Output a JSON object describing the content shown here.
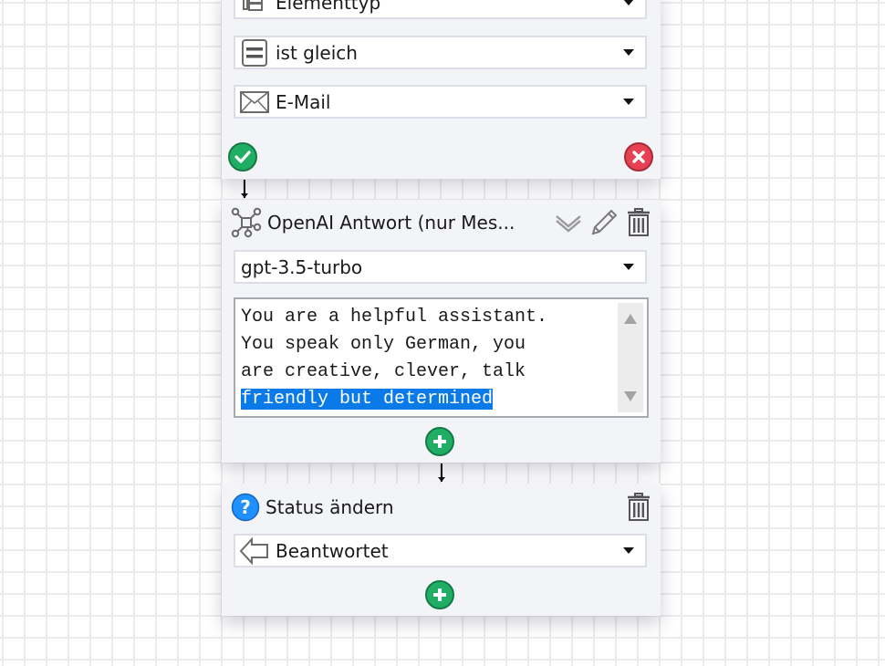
{
  "condition_block": {
    "field_select": {
      "icon": "element-type-icon",
      "value": "Elementtyp"
    },
    "operator_select": {
      "icon": "equals-icon",
      "value": "ist gleich"
    },
    "value_select": {
      "icon": "envelope-icon",
      "value": "E-Mail"
    },
    "confirm_icon": "check-icon",
    "cancel_icon": "close-icon"
  },
  "openai_block": {
    "icon": "network-icon",
    "title": "OpenAI Antwort (nur Mes...",
    "actions": [
      "collapse-icon",
      "pencil-icon",
      "trash-icon"
    ],
    "model_select": {
      "value": "gpt-3.5-turbo"
    },
    "prompt": {
      "lines": [
        "You are a helpful assistant.",
        "You speak only German, you",
        "are creative, clever, talk"
      ],
      "selected_line": "friendly but determined"
    },
    "add_icon": "plus-icon"
  },
  "status_block": {
    "icon": "question-icon",
    "title": "Status ändern",
    "actions": [
      "trash-icon"
    ],
    "status_select": {
      "icon": "arrow-left-icon",
      "value": "Beantwortet"
    },
    "add_icon": "plus-icon"
  },
  "colors": {
    "success": "#1fae64",
    "danger": "#e64152",
    "info": "#1e90ff",
    "selection": "#0a7ae8",
    "panel_bg": "#f3f4f8"
  }
}
